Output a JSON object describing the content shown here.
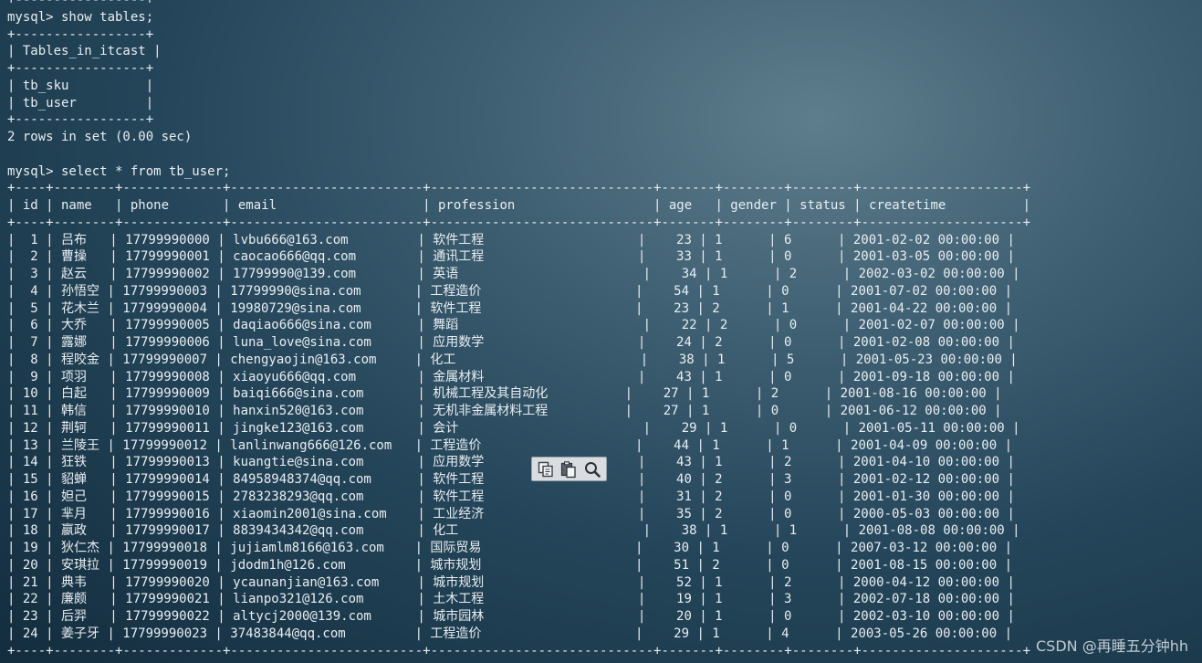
{
  "terminal": {
    "lines": [
      "+-----------------+",
      "mysql> show tables;",
      "+-----------------+",
      "| Tables_in_itcast |",
      "+-----------------+",
      "| tb_sku          |",
      "| tb_user         |",
      "+-----------------+",
      "2 rows in set (0.00 sec)",
      "",
      "mysql> select * from tb_user;",
      "+----+--------+-------------+-------------------------+-----------------------------+-------+--------+--------+---------------------+",
      "| id | name   | phone       | email                   | profession                  | age   | gender | status | createtime          |",
      "+----+--------+-------------+-------------------------+-----------------------------+-------+--------+--------+---------------------+",
      "|  1 | 吕布   | 17799990000 | lvbu666@163.com         | 软件工程                    |    23 | 1      | 6      | 2001-02-02 00:00:00 |",
      "|  2 | 曹操   | 17799990001 | caocao666@qq.com        | 通讯工程                    |    33 | 1      | 0      | 2001-03-05 00:00:00 |",
      "|  3 | 赵云   | 17799990002 | 17799990@139.com        | 英语                        |    34 | 1      | 2      | 2002-03-02 00:00:00 |",
      "|  4 | 孙悟空 | 17799990003 | 17799990@sina.com       | 工程造价                    |    54 | 1      | 0      | 2001-07-02 00:00:00 |",
      "|  5 | 花木兰 | 17799990004 | 19980729@sina.com       | 软件工程                    |    23 | 2      | 1      | 2001-04-22 00:00:00 |",
      "|  6 | 大乔   | 17799990005 | daqiao666@sina.com      | 舞蹈                        |    22 | 2      | 0      | 2001-02-07 00:00:00 |",
      "|  7 | 露娜   | 17799990006 | luna_love@sina.com      | 应用数学                    |    24 | 2      | 0      | 2001-02-08 00:00:00 |",
      "|  8 | 程咬金 | 17799990007 | chengyaojin@163.com     | 化工                        |    38 | 1      | 5      | 2001-05-23 00:00:00 |",
      "|  9 | 项羽   | 17799990008 | xiaoyu666@qq.com        | 金属材料                    |    43 | 1      | 0      | 2001-09-18 00:00:00 |",
      "| 10 | 白起   | 17799990009 | baiqi666@sina.com       | 机械工程及其自动化          |    27 | 1      | 2      | 2001-08-16 00:00:00 |",
      "| 11 | 韩信   | 17799990010 | hanxin520@163.com       | 无机非金属材料工程          |    27 | 1      | 0      | 2001-06-12 00:00:00 |",
      "| 12 | 荆轲   | 17799990011 | jingke123@163.com       | 会计                        |    29 | 1      | 0      | 2001-05-11 00:00:00 |",
      "| 13 | 兰陵王 | 17799990012 | lanlinwang666@126.com   | 工程造价                    |    44 | 1      | 1      | 2001-04-09 00:00:00 |",
      "| 14 | 狂铁   | 17799990013 | kuangtie@sina.com       | 应用数学                    |    43 | 1      | 2      | 2001-04-10 00:00:00 |",
      "| 15 | 貂蝉   | 17799990014 | 84958948374@qq.com      | 软件工程                    |    40 | 2      | 3      | 2001-02-12 00:00:00 |",
      "| 16 | 妲己   | 17799990015 | 2783238293@qq.com       | 软件工程                    |    31 | 2      | 0      | 2001-01-30 00:00:00 |",
      "| 17 | 芈月   | 17799990016 | xiaomin2001@sina.com    | 工业经济                    |    35 | 2      | 0      | 2000-05-03 00:00:00 |",
      "| 18 | 嬴政   | 17799990017 | 8839434342@qq.com       | 化工                        |    38 | 1      | 1      | 2001-08-08 00:00:00 |",
      "| 19 | 狄仁杰 | 17799990018 | jujiamlm8166@163.com    | 国际贸易                    |    30 | 1      | 0      | 2007-03-12 00:00:00 |",
      "| 20 | 安琪拉 | 17799990019 | jdodm1h@126.com         | 城市规划                    |    51 | 2      | 0      | 2001-08-15 00:00:00 |",
      "| 21 | 典韦   | 17799990020 | ycaunanjian@163.com     | 城市规划                    |    52 | 1      | 2      | 2000-04-12 00:00:00 |",
      "| 22 | 廉颇   | 17799990021 | lianpo321@126.com       | 土木工程                    |    19 | 1      | 3      | 2002-07-18 00:00:00 |",
      "| 23 | 后羿   | 17799990022 | altycj2000@139.com      | 城市园林                    |    20 | 1      | 0      | 2002-03-10 00:00:00 |",
      "| 24 | 姜子牙 | 17799990023 | 37483844@qq.com         | 工程造价                    |    29 | 1      | 4      | 2003-05-26 00:00:00 |",
      "+----+--------+-------------+-------------------------+-----------------------------+-------+--------+--------+---------------------+"
    ]
  },
  "toolbar": {
    "icons": [
      "copy-icon",
      "paste-icon",
      "search-icon"
    ]
  },
  "watermark": "CSDN @再睡五分钟hh"
}
